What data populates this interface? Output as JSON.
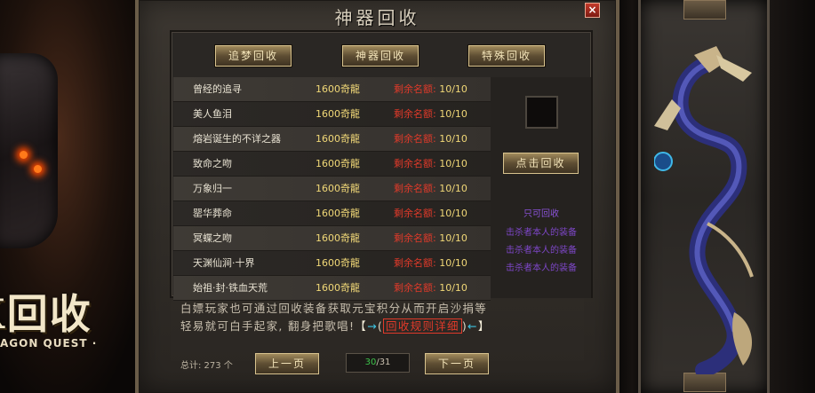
{
  "background": {
    "left_logo_text": "X回收",
    "left_tagline": "AGON QUEST ·"
  },
  "dialog": {
    "title": "神器回收",
    "close_label": "×",
    "tabs": [
      {
        "label": "追梦回收"
      },
      {
        "label": "神器回收"
      },
      {
        "label": "特殊回收"
      }
    ],
    "items": [
      {
        "name": "曾经的追寻",
        "price": "1600奇龍",
        "remain_label": "剩余名额:",
        "remain": "10/10"
      },
      {
        "name": "美人鱼泪",
        "price": "1600奇龍",
        "remain_label": "剩余名额:",
        "remain": "10/10"
      },
      {
        "name": "熔岩诞生的不详之器",
        "price": "1600奇龍",
        "remain_label": "剩余名额:",
        "remain": "10/10"
      },
      {
        "name": "致命之吻",
        "price": "1600奇龍",
        "remain_label": "剩余名额:",
        "remain": "10/10"
      },
      {
        "name": "万象归一",
        "price": "1600奇龍",
        "remain_label": "剩余名额:",
        "remain": "10/10"
      },
      {
        "name": "罂华葬命",
        "price": "1600奇龍",
        "remain_label": "剩余名额:",
        "remain": "10/10"
      },
      {
        "name": "冥蝶之吻",
        "price": "1600奇龍",
        "remain_label": "剩余名额:",
        "remain": "10/10"
      },
      {
        "name": "天渊仙涧·十界",
        "price": "1600奇龍",
        "remain_label": "剩余名额:",
        "remain": "10/10"
      },
      {
        "name": "始祖·封·铁血天荒",
        "price": "1600奇龍",
        "remain_label": "剩余名额:",
        "remain": "10/10"
      }
    ],
    "side": {
      "recycle_button": "点击回收",
      "note_head": "只可回收",
      "note_lines": [
        "击杀者本人的装备",
        "击杀者本人的装备",
        "击杀者本人的装备"
      ]
    },
    "info": {
      "line1": "白嫖玩家也可通过回收装备获取元宝积分从而开启沙捐等",
      "line2_text": "轻易就可白手起家, 翻身把歌唱!",
      "bracket_open": "【",
      "arrow_right": "→",
      "paren_open": "(",
      "link_label": "回收规则详细",
      "paren_close": ")",
      "arrow_left": "←",
      "bracket_close": "】"
    },
    "footer": {
      "total_label": "总计: 273 个",
      "prev_label": "上一页",
      "next_label": "下一页",
      "page_current": "30",
      "page_sep": "/",
      "page_total": "31"
    }
  },
  "colors": {
    "price": "#f1d877",
    "remain_label": "#e03a2a",
    "note": "#7e47c9",
    "page_current": "#3cc34a"
  }
}
